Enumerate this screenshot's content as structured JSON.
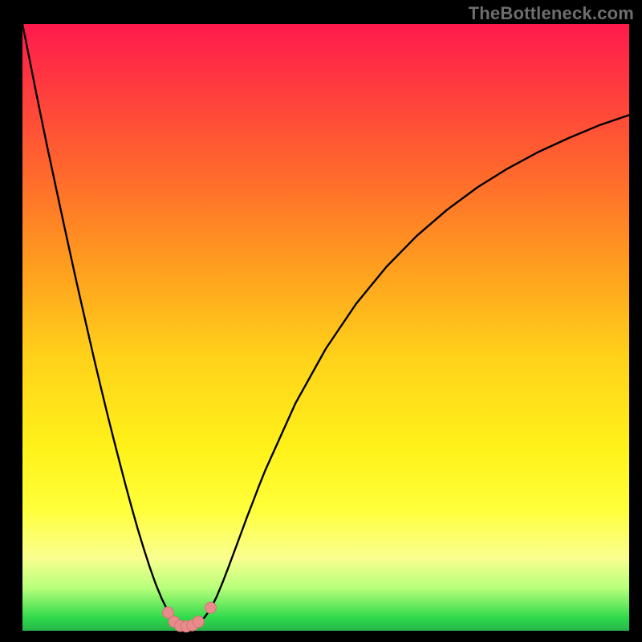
{
  "watermark": "TheBottleneck.com",
  "colors": {
    "background": "#000000",
    "curve": "#000000",
    "marker_fill": "#e98b8b",
    "marker_stroke": "#d07777",
    "gradient_stops": [
      "#ff1a4d",
      "#ff3a3f",
      "#ff6a2c",
      "#ff9e1f",
      "#ffd21a",
      "#fff21a",
      "#ffff3a",
      "#faff90",
      "#b6ff7a",
      "#2dd84a",
      "#28b44a"
    ]
  },
  "chart_data": {
    "type": "line",
    "title": "",
    "xlabel": "",
    "ylabel": "",
    "xlim": [
      0,
      100
    ],
    "ylim": [
      0,
      100
    ],
    "x": [
      0,
      1,
      2,
      3,
      4,
      5,
      6,
      7,
      8,
      9,
      10,
      11,
      12,
      13,
      14,
      15,
      16,
      17,
      18,
      19,
      20,
      21,
      22,
      23,
      24,
      25,
      26,
      27,
      28,
      29,
      30,
      31,
      32,
      33,
      34,
      35,
      36,
      37,
      38,
      39,
      40,
      45,
      50,
      55,
      60,
      65,
      70,
      75,
      80,
      85,
      90,
      95,
      100
    ],
    "y": [
      100.0,
      95.0,
      90.0,
      85.0,
      80.2,
      75.5,
      70.8,
      66.2,
      61.6,
      57.1,
      52.7,
      48.3,
      44.0,
      39.8,
      35.7,
      31.7,
      27.8,
      24.0,
      20.3,
      16.8,
      13.5,
      10.4,
      7.6,
      5.2,
      3.2,
      1.8,
      1.0,
      0.8,
      1.0,
      1.4,
      2.2,
      3.6,
      5.6,
      8.0,
      10.6,
      13.3,
      16.0,
      18.7,
      21.3,
      23.9,
      26.4,
      37.5,
      46.5,
      53.9,
      60.0,
      65.1,
      69.4,
      73.1,
      76.2,
      78.9,
      81.2,
      83.3,
      85.0
    ],
    "markers": [
      {
        "x": 24.0,
        "y": 3.0
      },
      {
        "x": 25.0,
        "y": 1.5
      },
      {
        "x": 26.0,
        "y": 0.8
      },
      {
        "x": 27.0,
        "y": 0.7
      },
      {
        "x": 28.0,
        "y": 0.9
      },
      {
        "x": 29.0,
        "y": 1.5
      },
      {
        "x": 31.0,
        "y": 3.8
      }
    ],
    "grid": false,
    "legend": false
  }
}
